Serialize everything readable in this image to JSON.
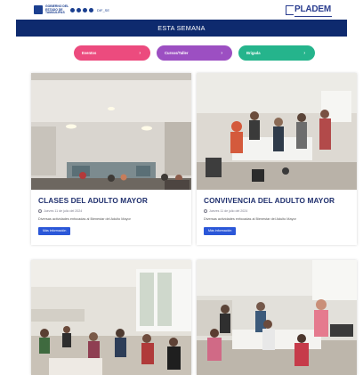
{
  "header": {
    "left_logo_text": "GOBIERNO DEL ESTADO DE TAMAULIPAS",
    "social_handle": "DIF_SE",
    "right_logo_text": "PLADEM"
  },
  "banner": {
    "title": "ESTA SEMANA"
  },
  "pills": [
    {
      "label": "Eventos",
      "arrow": "›"
    },
    {
      "label": "Cursos/Taller",
      "arrow": "›"
    },
    {
      "label": "Brigada",
      "arrow": "›"
    }
  ],
  "cards": [
    {
      "title": "CLASES DEL ADULTO MAYOR",
      "date": "Jueves 11 de julio del 2024",
      "description": "Diversas actividades enfocadas al Bienestar del Adulto Mayor",
      "button": "Más información"
    },
    {
      "title": "CONVIVENCIA DEL ADULTO MAYOR",
      "date": "Jueves 11 de julio del 2024",
      "description": "Diversas actividades enfocadas al Bienestar del Adulto Mayor",
      "button": "Más información"
    }
  ],
  "colors": {
    "navy": "#0e2a6e",
    "pink": "#ec4b7e",
    "purple": "#9c4fc2",
    "green": "#25b48c",
    "button_blue": "#2b57d8",
    "title_blue": "#20306e"
  }
}
